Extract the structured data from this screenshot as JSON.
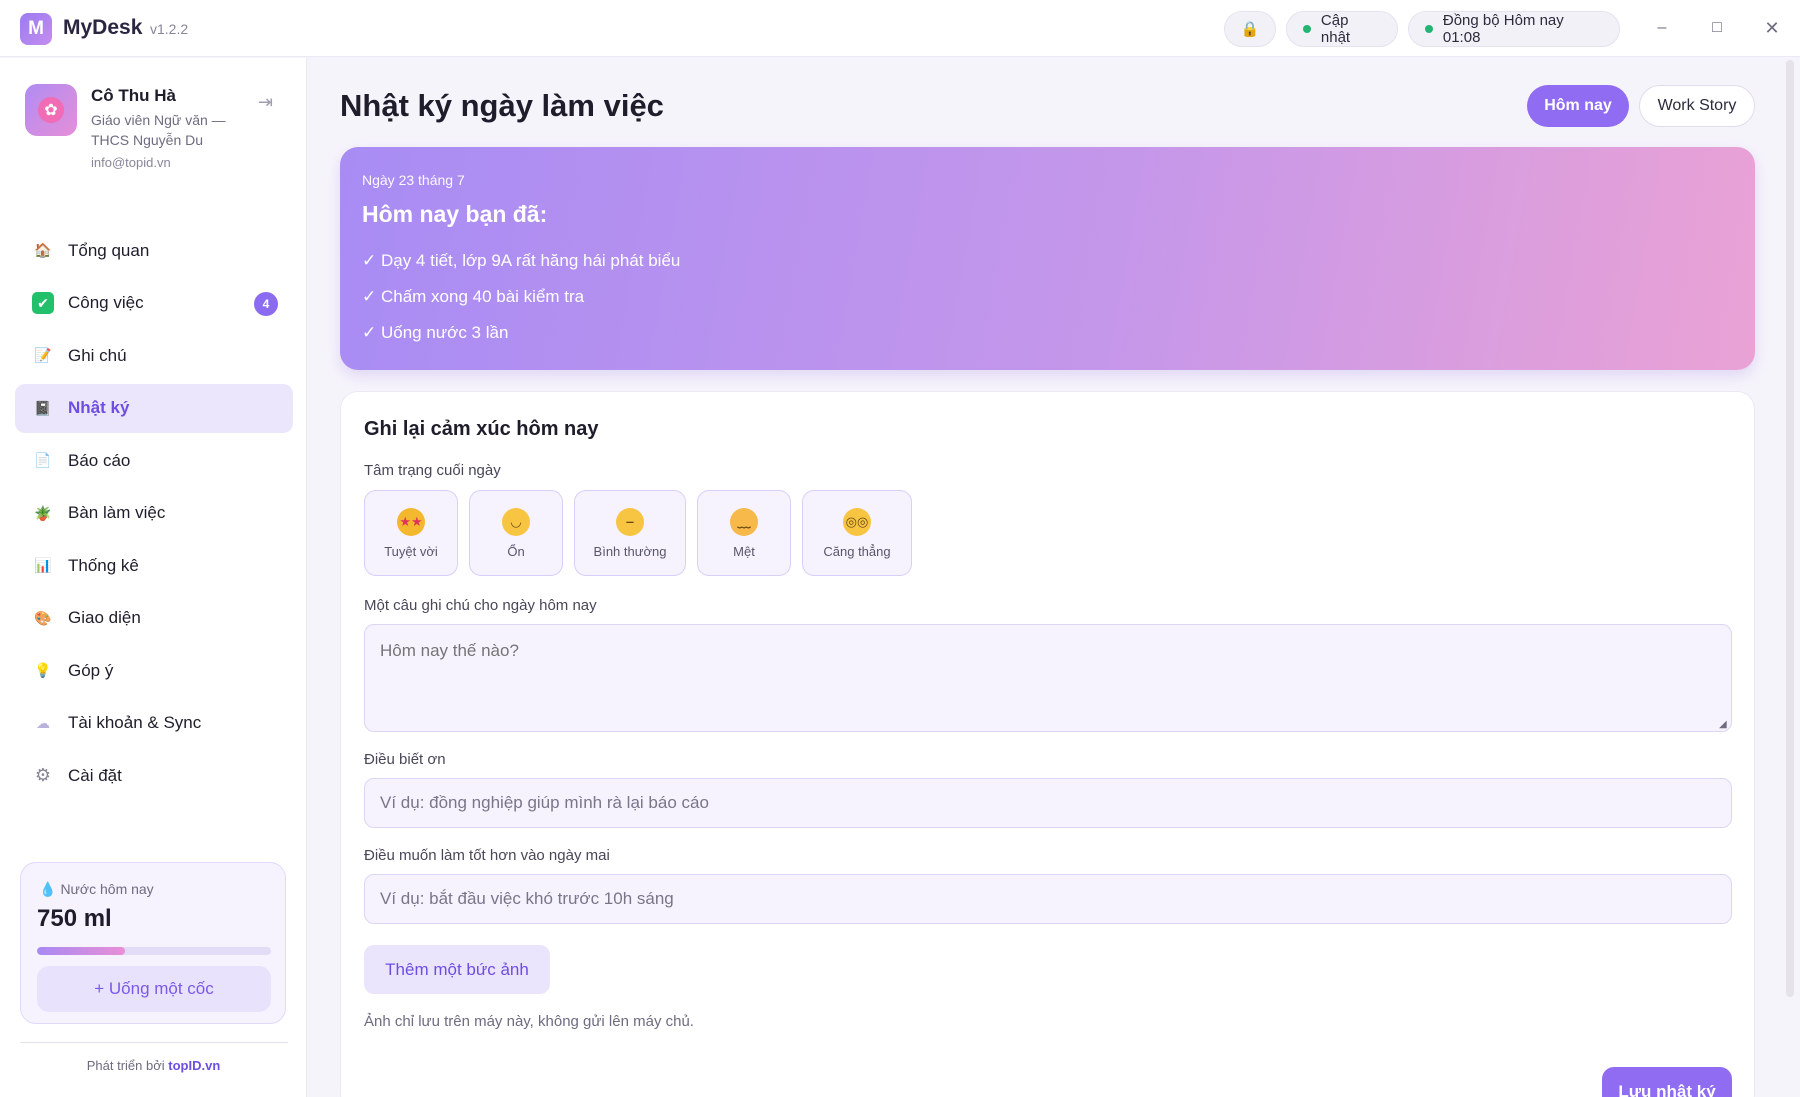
{
  "app": {
    "logo_letter": "M",
    "name": "MyDesk",
    "version": "v1.2.2"
  },
  "titlebar": {
    "lock_icon": "🔒",
    "update_label": "Cập nhật",
    "sync_label": "Đồng bộ Hôm nay 01:08",
    "window_controls": {
      "minimize": "–",
      "maximize": "□",
      "close": "✕"
    }
  },
  "profile": {
    "name": "Cô Thu Hà",
    "role": "Giáo viên Ngữ văn — THCS Nguyễn Du",
    "email": "info@topid.vn",
    "logout_icon": "⇥"
  },
  "nav": {
    "items": [
      {
        "label": "Tổng quan",
        "icon": "🏠"
      },
      {
        "label": "Công việc",
        "icon": "✔",
        "badge": "4"
      },
      {
        "label": "Ghi chú",
        "icon": "📝"
      },
      {
        "label": "Nhật ký",
        "icon": "📓",
        "active": true
      },
      {
        "label": "Báo cáo",
        "icon": "📄"
      },
      {
        "label": "Bàn làm việc",
        "icon": "🪴"
      },
      {
        "label": "Thống kê",
        "icon": "📊"
      },
      {
        "label": "Giao diện",
        "icon": "🎨"
      },
      {
        "label": "Góp ý",
        "icon": "💡"
      },
      {
        "label": "Tài khoản & Sync",
        "icon": "☁"
      },
      {
        "label": "Cài đặt",
        "icon": "⚙"
      }
    ]
  },
  "water": {
    "label": "Nước hôm nay",
    "value": "750 ml",
    "progress_fraction": 0.375,
    "button_label": "+ Uống một cốc"
  },
  "footer": {
    "prefix": "Phát triển bởi",
    "brand": "topID.vn"
  },
  "main": {
    "title": "Nhật ký ngày làm việc",
    "tabs": {
      "today": "Hôm nay",
      "story": "Work Story"
    },
    "summary": {
      "date": "Ngày 23 tháng 7",
      "heading": "Hôm nay bạn đã:",
      "items": [
        "✓ Dạy 4 tiết, lớp 9A rất hăng hái phát biểu",
        "✓ Chấm xong 40 bài kiểm tra",
        "✓ Uống nước 3 lần"
      ]
    },
    "form": {
      "title": "Ghi lại cảm xúc hôm nay",
      "mood_label": "Tâm trạng cuối ngày",
      "moods": [
        {
          "label": "Tuyệt vời",
          "icon": "star-struck-face"
        },
        {
          "label": "Ổn",
          "icon": "smiling-face"
        },
        {
          "label": "Bình thường",
          "icon": "neutral-face"
        },
        {
          "label": "Mệt",
          "icon": "tired-face"
        },
        {
          "label": "Căng thẳng",
          "icon": "anxious-face"
        }
      ],
      "note_label": "Một câu ghi chú cho ngày hôm nay",
      "note_placeholder": "Hôm nay thế nào?",
      "gratitude_label": "Điều biết ơn",
      "gratitude_placeholder": "Ví dụ: đồng nghiệp giúp mình rà lại báo cáo",
      "improve_label": "Điều muốn làm tốt hơn vào ngày mai",
      "improve_placeholder": "Ví dụ: bắt đầu việc khó trước 10h sáng",
      "photo_button": "Thêm một bức ảnh",
      "photo_note": "Ảnh chỉ lưu trên máy này, không gửi lên máy chủ.",
      "save_button": "Lưu nhật ký"
    }
  },
  "colors": {
    "accent": "#8f6cf1",
    "active_bg": "#ece6fd",
    "sync_dot": "#22b573"
  }
}
